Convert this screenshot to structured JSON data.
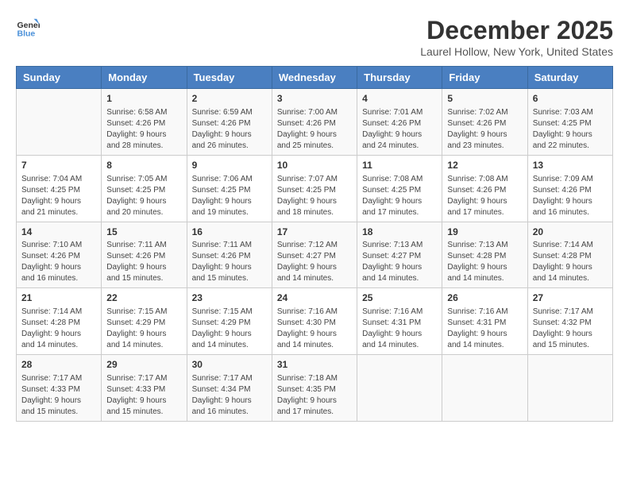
{
  "logo": {
    "text_general": "General",
    "text_blue": "Blue"
  },
  "title": "December 2025",
  "subtitle": "Laurel Hollow, New York, United States",
  "header_days": [
    "Sunday",
    "Monday",
    "Tuesday",
    "Wednesday",
    "Thursday",
    "Friday",
    "Saturday"
  ],
  "weeks": [
    [
      {
        "day": "",
        "info": ""
      },
      {
        "day": "1",
        "info": "Sunrise: 6:58 AM\nSunset: 4:26 PM\nDaylight: 9 hours\nand 28 minutes."
      },
      {
        "day": "2",
        "info": "Sunrise: 6:59 AM\nSunset: 4:26 PM\nDaylight: 9 hours\nand 26 minutes."
      },
      {
        "day": "3",
        "info": "Sunrise: 7:00 AM\nSunset: 4:26 PM\nDaylight: 9 hours\nand 25 minutes."
      },
      {
        "day": "4",
        "info": "Sunrise: 7:01 AM\nSunset: 4:26 PM\nDaylight: 9 hours\nand 24 minutes."
      },
      {
        "day": "5",
        "info": "Sunrise: 7:02 AM\nSunset: 4:26 PM\nDaylight: 9 hours\nand 23 minutes."
      },
      {
        "day": "6",
        "info": "Sunrise: 7:03 AM\nSunset: 4:25 PM\nDaylight: 9 hours\nand 22 minutes."
      }
    ],
    [
      {
        "day": "7",
        "info": "Sunrise: 7:04 AM\nSunset: 4:25 PM\nDaylight: 9 hours\nand 21 minutes."
      },
      {
        "day": "8",
        "info": "Sunrise: 7:05 AM\nSunset: 4:25 PM\nDaylight: 9 hours\nand 20 minutes."
      },
      {
        "day": "9",
        "info": "Sunrise: 7:06 AM\nSunset: 4:25 PM\nDaylight: 9 hours\nand 19 minutes."
      },
      {
        "day": "10",
        "info": "Sunrise: 7:07 AM\nSunset: 4:25 PM\nDaylight: 9 hours\nand 18 minutes."
      },
      {
        "day": "11",
        "info": "Sunrise: 7:08 AM\nSunset: 4:25 PM\nDaylight: 9 hours\nand 17 minutes."
      },
      {
        "day": "12",
        "info": "Sunrise: 7:08 AM\nSunset: 4:26 PM\nDaylight: 9 hours\nand 17 minutes."
      },
      {
        "day": "13",
        "info": "Sunrise: 7:09 AM\nSunset: 4:26 PM\nDaylight: 9 hours\nand 16 minutes."
      }
    ],
    [
      {
        "day": "14",
        "info": "Sunrise: 7:10 AM\nSunset: 4:26 PM\nDaylight: 9 hours\nand 16 minutes."
      },
      {
        "day": "15",
        "info": "Sunrise: 7:11 AM\nSunset: 4:26 PM\nDaylight: 9 hours\nand 15 minutes."
      },
      {
        "day": "16",
        "info": "Sunrise: 7:11 AM\nSunset: 4:26 PM\nDaylight: 9 hours\nand 15 minutes."
      },
      {
        "day": "17",
        "info": "Sunrise: 7:12 AM\nSunset: 4:27 PM\nDaylight: 9 hours\nand 14 minutes."
      },
      {
        "day": "18",
        "info": "Sunrise: 7:13 AM\nSunset: 4:27 PM\nDaylight: 9 hours\nand 14 minutes."
      },
      {
        "day": "19",
        "info": "Sunrise: 7:13 AM\nSunset: 4:28 PM\nDaylight: 9 hours\nand 14 minutes."
      },
      {
        "day": "20",
        "info": "Sunrise: 7:14 AM\nSunset: 4:28 PM\nDaylight: 9 hours\nand 14 minutes."
      }
    ],
    [
      {
        "day": "21",
        "info": "Sunrise: 7:14 AM\nSunset: 4:28 PM\nDaylight: 9 hours\nand 14 minutes."
      },
      {
        "day": "22",
        "info": "Sunrise: 7:15 AM\nSunset: 4:29 PM\nDaylight: 9 hours\nand 14 minutes."
      },
      {
        "day": "23",
        "info": "Sunrise: 7:15 AM\nSunset: 4:29 PM\nDaylight: 9 hours\nand 14 minutes."
      },
      {
        "day": "24",
        "info": "Sunrise: 7:16 AM\nSunset: 4:30 PM\nDaylight: 9 hours\nand 14 minutes."
      },
      {
        "day": "25",
        "info": "Sunrise: 7:16 AM\nSunset: 4:31 PM\nDaylight: 9 hours\nand 14 minutes."
      },
      {
        "day": "26",
        "info": "Sunrise: 7:16 AM\nSunset: 4:31 PM\nDaylight: 9 hours\nand 14 minutes."
      },
      {
        "day": "27",
        "info": "Sunrise: 7:17 AM\nSunset: 4:32 PM\nDaylight: 9 hours\nand 15 minutes."
      }
    ],
    [
      {
        "day": "28",
        "info": "Sunrise: 7:17 AM\nSunset: 4:33 PM\nDaylight: 9 hours\nand 15 minutes."
      },
      {
        "day": "29",
        "info": "Sunrise: 7:17 AM\nSunset: 4:33 PM\nDaylight: 9 hours\nand 15 minutes."
      },
      {
        "day": "30",
        "info": "Sunrise: 7:17 AM\nSunset: 4:34 PM\nDaylight: 9 hours\nand 16 minutes."
      },
      {
        "day": "31",
        "info": "Sunrise: 7:18 AM\nSunset: 4:35 PM\nDaylight: 9 hours\nand 17 minutes."
      },
      {
        "day": "",
        "info": ""
      },
      {
        "day": "",
        "info": ""
      },
      {
        "day": "",
        "info": ""
      }
    ]
  ]
}
